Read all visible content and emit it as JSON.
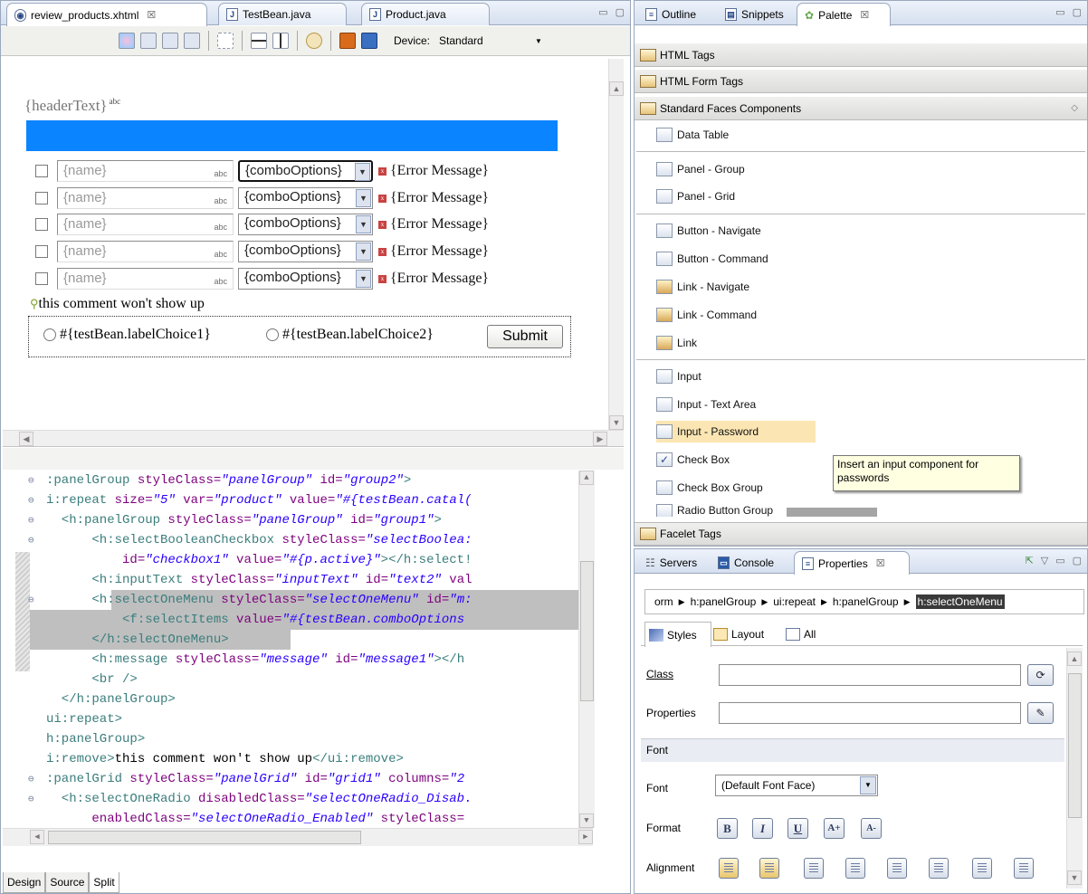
{
  "editor": {
    "tabs": [
      {
        "label": "review_products.xhtml",
        "close": "☒"
      },
      {
        "label": "TestBean.java"
      },
      {
        "label": "Product.java"
      }
    ],
    "toolbar": {
      "device_label": "Device:",
      "device_value": "Standard"
    },
    "design": {
      "header_text": "{headerText}",
      "abc": "abc",
      "rows": [
        {
          "name": "{name}",
          "combo": "{comboOptions}",
          "error": "{Error Message}"
        },
        {
          "name": "{name}",
          "combo": "{comboOptions}",
          "error": "{Error Message}"
        },
        {
          "name": "{name}",
          "combo": "{comboOptions}",
          "error": "{Error Message}"
        },
        {
          "name": "{name}",
          "combo": "{comboOptions}",
          "error": "{Error Message}"
        },
        {
          "name": "{name}",
          "combo": "{comboOptions}",
          "error": "{Error Message}"
        }
      ],
      "comment": "this comment won't show up",
      "radio1": "#{testBean.labelChoice1}",
      "radio2": "#{testBean.labelChoice2}",
      "submit": "Submit"
    },
    "source_lines": [
      [
        {
          "c": "tag",
          "t": ":panelGroup "
        },
        {
          "c": "attr",
          "t": "styleClass="
        },
        {
          "c": "val",
          "t": "\"panelGroup\""
        },
        {
          "c": "attr",
          "t": " id="
        },
        {
          "c": "val",
          "t": "\"group2\""
        },
        {
          "c": "tag",
          "t": ">"
        }
      ],
      [
        {
          "c": "tag",
          "t": "i:repeat "
        },
        {
          "c": "attr",
          "t": "size="
        },
        {
          "c": "val",
          "t": "\"5\""
        },
        {
          "c": "attr",
          "t": " var="
        },
        {
          "c": "val",
          "t": "\"product\""
        },
        {
          "c": "attr",
          "t": " value="
        },
        {
          "c": "val",
          "t": "\"#{testBean.catal("
        }
      ],
      [
        {
          "c": "tag",
          "t": "  <h:panelGroup "
        },
        {
          "c": "attr",
          "t": "styleClass="
        },
        {
          "c": "val",
          "t": "\"panelGroup\""
        },
        {
          "c": "attr",
          "t": " id="
        },
        {
          "c": "val",
          "t": "\"group1\""
        },
        {
          "c": "tag",
          "t": ">"
        }
      ],
      [
        {
          "c": "tag",
          "t": "      <h:selectBooleanCheckbox "
        },
        {
          "c": "attr",
          "t": "styleClass="
        },
        {
          "c": "val",
          "t": "\"selectBoolea:"
        }
      ],
      [
        {
          "c": "attr",
          "t": "          id="
        },
        {
          "c": "val",
          "t": "\"checkbox1\""
        },
        {
          "c": "attr",
          "t": " value="
        },
        {
          "c": "val",
          "t": "\"#{p.active}\""
        },
        {
          "c": "tag",
          "t": "></h:select!"
        }
      ],
      [
        {
          "c": "tag",
          "t": "      <h:inputText "
        },
        {
          "c": "attr",
          "t": "styleClass="
        },
        {
          "c": "val",
          "t": "\"inputText\""
        },
        {
          "c": "attr",
          "t": " id="
        },
        {
          "c": "val",
          "t": "\"text2\""
        },
        {
          "c": "attr",
          "t": " val"
        }
      ],
      [
        {
          "c": "tag",
          "t": "      <h:selectOneMenu "
        },
        {
          "c": "attr",
          "t": "styleClass="
        },
        {
          "c": "val",
          "t": "\"selectOneMenu\""
        },
        {
          "c": "attr",
          "t": " id="
        },
        {
          "c": "val",
          "t": "\"m:"
        }
      ],
      [
        {
          "c": "tag",
          "t": "          <f:selectItems "
        },
        {
          "c": "attr",
          "t": "value="
        },
        {
          "c": "val",
          "t": "\"#{testBean.comboOptions"
        }
      ],
      [
        {
          "c": "tag",
          "t": "      </h:selectOneMenu>"
        }
      ],
      [
        {
          "c": "tag",
          "t": "      <h:message "
        },
        {
          "c": "attr",
          "t": "styleClass="
        },
        {
          "c": "val",
          "t": "\"message\""
        },
        {
          "c": "attr",
          "t": " id="
        },
        {
          "c": "val",
          "t": "\"message1\""
        },
        {
          "c": "tag",
          "t": "></h"
        }
      ],
      [
        {
          "c": "tag",
          "t": "      <br />"
        }
      ],
      [
        {
          "c": "tag",
          "t": "  </h:panelGroup>"
        }
      ],
      [
        {
          "c": "tag",
          "t": "ui:repeat>"
        }
      ],
      [
        {
          "c": "tag",
          "t": "h:panelGroup>"
        }
      ],
      [
        {
          "c": "tag",
          "t": "i:remove>"
        },
        {
          "c": "txt",
          "t": "this comment won't show up"
        },
        {
          "c": "tag",
          "t": "</ui:remove>"
        }
      ],
      [
        {
          "c": "tag",
          "t": ":panelGrid "
        },
        {
          "c": "attr",
          "t": "styleClass="
        },
        {
          "c": "val",
          "t": "\"panelGrid\""
        },
        {
          "c": "attr",
          "t": " id="
        },
        {
          "c": "val",
          "t": "\"grid1\""
        },
        {
          "c": "attr",
          "t": " columns="
        },
        {
          "c": "val",
          "t": "\"2"
        }
      ],
      [
        {
          "c": "tag",
          "t": "  <h:selectOneRadio "
        },
        {
          "c": "attr",
          "t": "disabledClass="
        },
        {
          "c": "val",
          "t": "\"selectOneRadio_Disab."
        }
      ],
      [
        {
          "c": "attr",
          "t": "      enabledClass="
        },
        {
          "c": "val",
          "t": "\"selectOneRadio_Enabled\""
        },
        {
          "c": "attr",
          "t": " styleClass="
        }
      ]
    ],
    "bottom_tabs": [
      "Design",
      "Source",
      "Split"
    ]
  },
  "palette": {
    "tabs": [
      {
        "label": "Outline"
      },
      {
        "label": "Snippets"
      },
      {
        "label": "Palette",
        "close": "☒"
      }
    ],
    "drawers": [
      "HTML Tags",
      "HTML Form Tags",
      "Standard Faces Components"
    ],
    "items": [
      "Data Table",
      "Panel - Group",
      "Panel - Grid",
      "Button - Navigate",
      "Button - Command",
      "Link - Navigate",
      "Link - Command",
      "Link",
      "Input",
      "Input - Text Area",
      "Input - Password",
      "Check Box",
      "Check Box Group",
      "Radio Button Group"
    ],
    "facelet": "Facelet Tags",
    "tooltip": "Insert an input component for passwords"
  },
  "properties": {
    "tabs": [
      {
        "label": "Servers"
      },
      {
        "label": "Console"
      },
      {
        "label": "Properties",
        "close": "☒"
      }
    ],
    "breadcrumb": [
      "orm",
      "h:panelGroup",
      "ui:repeat",
      "h:panelGroup",
      "h:selectOneMenu"
    ],
    "subtabs": [
      "Styles",
      "Layout",
      "All"
    ],
    "class_label": "Class",
    "properties_label": "Properties",
    "font_section": "Font",
    "font_label": "Font",
    "font_value": "(Default Font Face)",
    "format_label": "Format",
    "alignment_label": "Alignment",
    "format_buttons": [
      "B",
      "I",
      "U",
      "A+",
      "A-"
    ]
  }
}
